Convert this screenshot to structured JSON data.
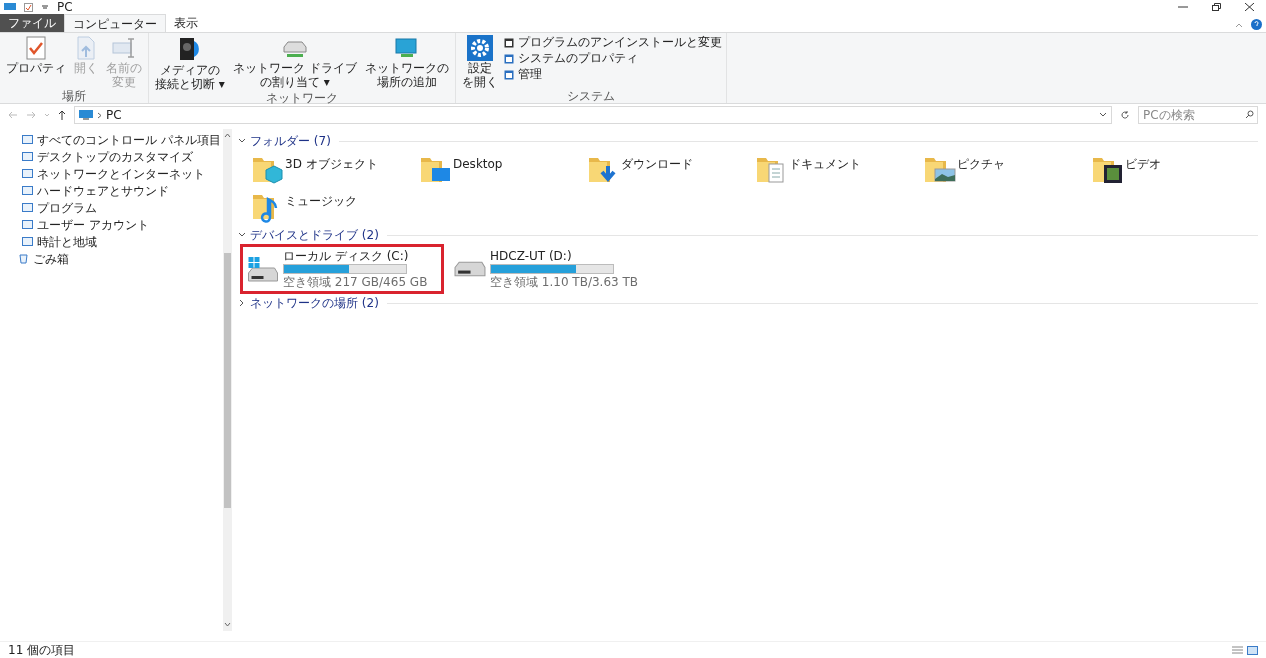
{
  "window": {
    "title": "PC"
  },
  "tabs": [
    {
      "label": "ファイル",
      "kind": "file",
      "selected": false
    },
    {
      "label": "コンピューター",
      "kind": "tab",
      "selected": true
    },
    {
      "label": "表示",
      "kind": "tab",
      "selected": false
    }
  ],
  "ribbon": {
    "groups": [
      {
        "label": "場所",
        "buttons": [
          {
            "lines": [
              "プロパティ"
            ],
            "kind": "properties",
            "disabled": false
          },
          {
            "lines": [
              "開く"
            ],
            "kind": "open",
            "disabled": true
          },
          {
            "lines": [
              "名前の",
              "変更"
            ],
            "kind": "rename",
            "disabled": true
          }
        ]
      },
      {
        "label": "ネットワーク",
        "buttons": [
          {
            "lines": [
              "メディアの",
              "接続と切断 ▾"
            ],
            "kind": "media",
            "disabled": false
          },
          {
            "lines": [
              "ネットワーク ドライブ",
              "の割り当て ▾"
            ],
            "kind": "netdrive",
            "disabled": false
          },
          {
            "lines": [
              "ネットワークの",
              "場所の追加"
            ],
            "kind": "netplace",
            "disabled": false
          }
        ]
      },
      {
        "label": "システム",
        "buttons": [
          {
            "lines": [
              "設定",
              "を開く"
            ],
            "kind": "settings",
            "disabled": false
          }
        ],
        "small_buttons": [
          "プログラムのアンインストールと変更",
          "システムのプロパティ",
          "管理"
        ]
      }
    ]
  },
  "address": {
    "path": "PC",
    "search_placeholder": "PCの検索"
  },
  "sidebar": {
    "items": [
      {
        "label": "すべてのコントロール パネル項目",
        "kind": "panel"
      },
      {
        "label": "デスクトップのカスタマイズ",
        "kind": "panel"
      },
      {
        "label": "ネットワークとインターネット",
        "kind": "panel"
      },
      {
        "label": "ハードウェアとサウンド",
        "kind": "panel"
      },
      {
        "label": "プログラム",
        "kind": "panel"
      },
      {
        "label": "ユーザー アカウント",
        "kind": "panel"
      },
      {
        "label": "時計と地域",
        "kind": "panel"
      },
      {
        "label": "ごみ箱",
        "kind": "trash"
      }
    ]
  },
  "sections": [
    {
      "title": "フォルダー (7)",
      "expanded": true,
      "kind": "folders",
      "items": [
        {
          "name": "3D オブジェクト",
          "kind": "cube"
        },
        {
          "name": "Desktop",
          "kind": "desktop"
        },
        {
          "name": "ダウンロード",
          "kind": "download"
        },
        {
          "name": "ドキュメント",
          "kind": "document"
        },
        {
          "name": "ピクチャ",
          "kind": "picture"
        },
        {
          "name": "ビデオ",
          "kind": "video"
        },
        {
          "name": "ミュージック",
          "kind": "music"
        }
      ]
    },
    {
      "title": "デバイスとドライブ (2)",
      "expanded": true,
      "kind": "drives",
      "items": [
        {
          "name": "ローカル ディスク (C:)",
          "free": "空き領域 217 GB/465 GB",
          "level": 0.53,
          "system": true,
          "highlighted": true
        },
        {
          "name": "HDCZ-UT (D:)",
          "free": "空き領域 1.10 TB/3.63 TB",
          "level": 0.7,
          "system": false,
          "highlighted": false
        }
      ]
    },
    {
      "title": "ネットワークの場所 (2)",
      "expanded": false
    }
  ],
  "status_bar": {
    "count": "11 個の項目"
  }
}
